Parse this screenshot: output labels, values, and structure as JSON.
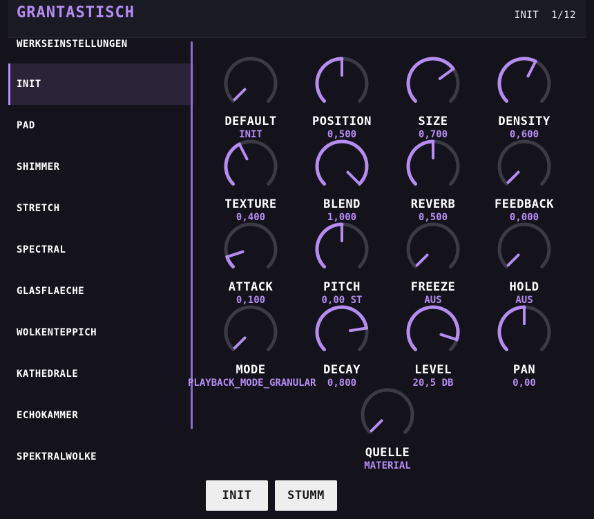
{
  "app": {
    "title": "GRANTASTISCH"
  },
  "header": {
    "preset_name": "INIT",
    "preset_index": "1/12"
  },
  "sidebar": {
    "header": "WERKSEINSTELLUNGEN",
    "items": [
      {
        "label": "INIT",
        "active": true
      },
      {
        "label": "PAD"
      },
      {
        "label": "SHIMMER"
      },
      {
        "label": "STRETCH"
      },
      {
        "label": "SPECTRAL"
      },
      {
        "label": "GLASFLAECHE"
      },
      {
        "label": "WOLKENTEPPICH"
      },
      {
        "label": "KATHEDRALE"
      },
      {
        "label": "ECHOKAMMER"
      },
      {
        "label": "SPEKTRALWOLKE"
      }
    ]
  },
  "knobs": [
    {
      "id": "default",
      "label": "DEFAULT",
      "value": "INIT",
      "level": 0
    },
    {
      "id": "position",
      "label": "POSITION",
      "value": "0,500",
      "level": 0.5
    },
    {
      "id": "size",
      "label": "SIZE",
      "value": "0,700",
      "level": 0.7
    },
    {
      "id": "density",
      "label": "DENSITY",
      "value": "0,600",
      "level": 0.6
    },
    {
      "id": "texture",
      "label": "TEXTURE",
      "value": "0,400",
      "level": 0.4
    },
    {
      "id": "blend",
      "label": "BLEND",
      "value": "1,000",
      "level": 1.0
    },
    {
      "id": "reverb",
      "label": "REVERB",
      "value": "0,500",
      "level": 0.5
    },
    {
      "id": "feedback",
      "label": "FEEDBACK",
      "value": "0,000",
      "level": 0
    },
    {
      "id": "attack",
      "label": "ATTACK",
      "value": "0,100",
      "level": 0.1
    },
    {
      "id": "pitch",
      "label": "PITCH",
      "value": "0,00 ST",
      "level": 0.5
    },
    {
      "id": "freeze",
      "label": "FREEZE",
      "value": "AUS",
      "level": 0
    },
    {
      "id": "hold",
      "label": "HOLD",
      "value": "AUS",
      "level": 0
    },
    {
      "id": "mode",
      "label": "MODE",
      "value": "PLAYBACK_MODE_GRANULAR",
      "level": 0
    },
    {
      "id": "decay",
      "label": "DECAY",
      "value": "0,800",
      "level": 0.8
    },
    {
      "id": "level",
      "label": "LEVEL",
      "value": "20,5 DB",
      "level": 0.9
    },
    {
      "id": "pan",
      "label": "PAN",
      "value": "0,00",
      "level": 0.5
    },
    {
      "id": "quelle",
      "label": "QUELLE",
      "value": "MATERIAL",
      "level": 0
    }
  ],
  "buttons": {
    "init_label": "INIT",
    "mute_label": "STUMM"
  },
  "colors": {
    "accent": "#b68cf2",
    "track": "#3c3b45",
    "background": "#14131c"
  }
}
